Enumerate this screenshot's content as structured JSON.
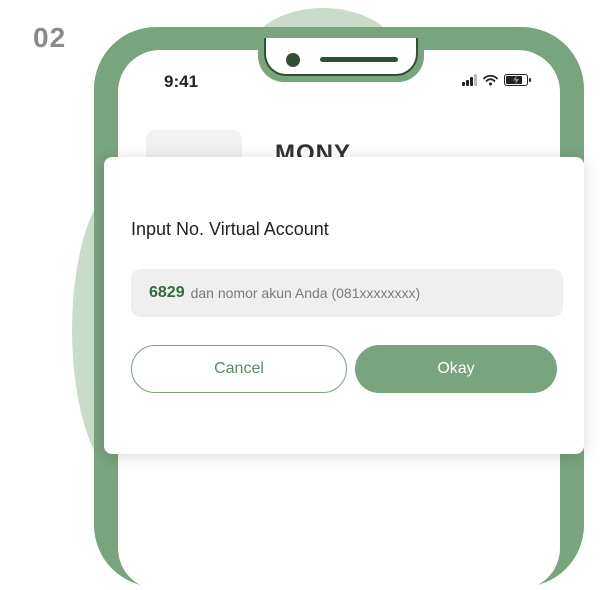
{
  "step_label": "02",
  "status_bar": {
    "time": "9:41"
  },
  "app": {
    "name": "MONY"
  },
  "dialog": {
    "title": "Input No. Virtual Account",
    "field": {
      "prefix": "6829",
      "placeholder": "dan nomor akun Anda (081xxxxxxxx)"
    },
    "cancel_label": "Cancel",
    "okay_label": "Okay"
  },
  "colors": {
    "accent": "#78a47e",
    "accent_dark": "#2f4f36",
    "blob": "#c9dcc9",
    "prefix_text": "#2f6b3c"
  }
}
